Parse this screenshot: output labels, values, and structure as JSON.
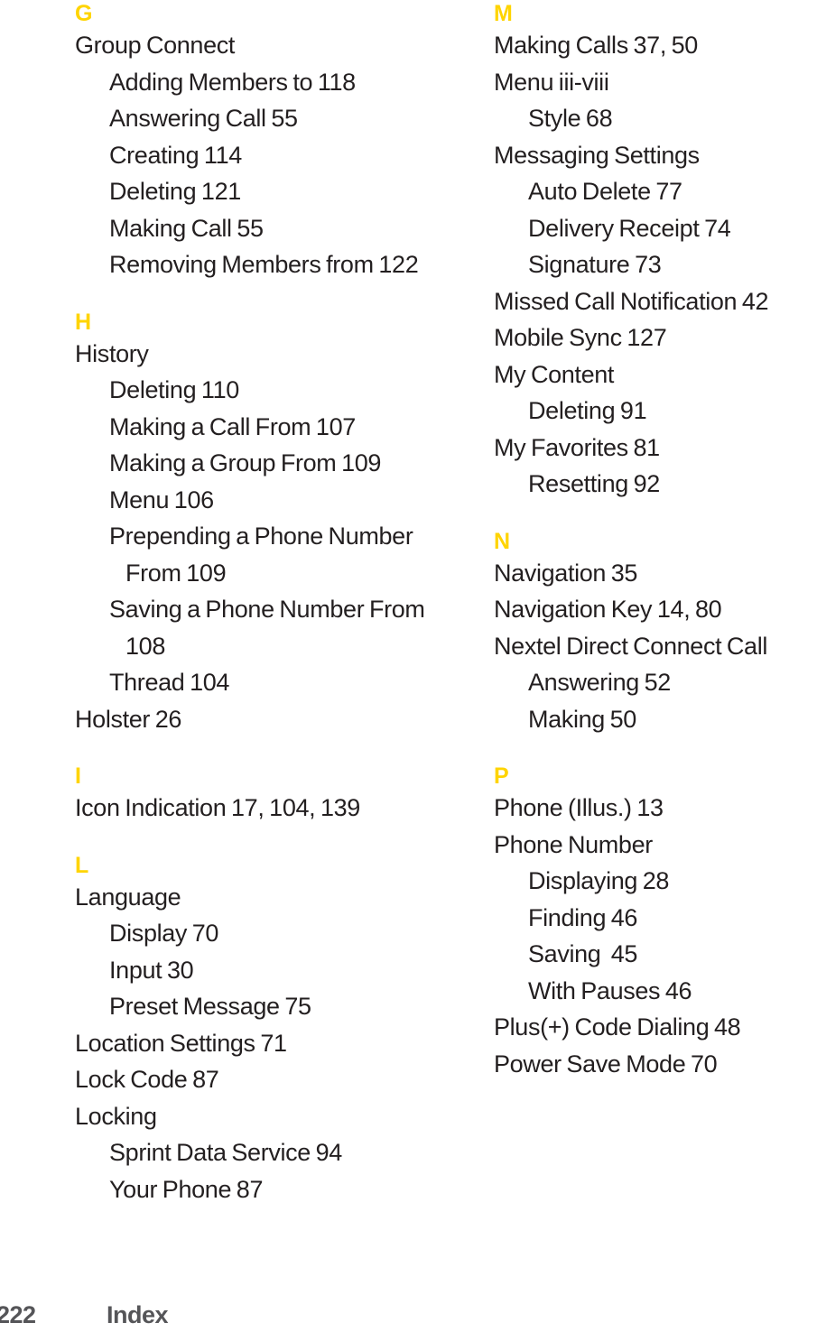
{
  "footer": {
    "page_number": "222",
    "label": "Index"
  },
  "colors": {
    "section_letter": "#FFD400",
    "body_text": "#231F20",
    "footer_text": "#555558"
  },
  "columns": [
    {
      "name": "left",
      "sections": [
        {
          "letter": "G",
          "entries": [
            {
              "level": 1,
              "text": "Group Connect"
            },
            {
              "level": 2,
              "text": "Adding Members to 118"
            },
            {
              "level": 2,
              "text": "Answering Call 55"
            },
            {
              "level": 2,
              "text": "Creating 114"
            },
            {
              "level": 2,
              "text": "Deleting 121"
            },
            {
              "level": 2,
              "text": "Making Call 55"
            },
            {
              "level": 2,
              "wrap": true,
              "text": "Removing Members from 122"
            }
          ]
        },
        {
          "letter": "H",
          "entries": [
            {
              "level": 1,
              "text": "History"
            },
            {
              "level": 2,
              "text": "Deleting 110"
            },
            {
              "level": 2,
              "text": "Making a Call From 107"
            },
            {
              "level": 2,
              "text": "Making a Group From 109"
            },
            {
              "level": 2,
              "text": "Menu 106"
            },
            {
              "level": 2,
              "wrap": true,
              "text": "Prepending a Phone Number From 109"
            },
            {
              "level": 2,
              "wrap": true,
              "text": "Saving a Phone Number From 108"
            },
            {
              "level": 2,
              "text": "Thread 104"
            },
            {
              "level": 1,
              "text": "Holster 26"
            }
          ]
        },
        {
          "letter": "I",
          "entries": [
            {
              "level": 1,
              "text": "Icon Indication 17, 104, 139"
            }
          ]
        },
        {
          "letter": "L",
          "entries": [
            {
              "level": 1,
              "text": "Language"
            },
            {
              "level": 2,
              "text": "Display 70"
            },
            {
              "level": 2,
              "text": "Input 30"
            },
            {
              "level": 2,
              "text": "Preset Message 75"
            },
            {
              "level": 1,
              "text": "Location Settings 71"
            },
            {
              "level": 1,
              "text": "Lock Code 87"
            },
            {
              "level": 1,
              "text": "Locking"
            },
            {
              "level": 2,
              "text": "Sprint Data Service 94"
            },
            {
              "level": 2,
              "text": "Your Phone 87"
            }
          ]
        }
      ]
    },
    {
      "name": "right",
      "sections": [
        {
          "letter": "M",
          "entries": [
            {
              "level": 1,
              "text": "Making Calls 37, 50"
            },
            {
              "level": 1,
              "text": "Menu iii-viii"
            },
            {
              "level": 2,
              "text": "Style 68"
            },
            {
              "level": 1,
              "text": "Messaging Settings"
            },
            {
              "level": 2,
              "text": "Auto Delete 77"
            },
            {
              "level": 2,
              "text": "Delivery Receipt 74"
            },
            {
              "level": 2,
              "text": "Signature 73"
            },
            {
              "level": 1,
              "text": "Missed Call Notification 42"
            },
            {
              "level": 1,
              "text": "Mobile Sync 127"
            },
            {
              "level": 1,
              "text": "My Content"
            },
            {
              "level": 2,
              "text": "Deleting 91"
            },
            {
              "level": 1,
              "text": "My Favorites 81"
            },
            {
              "level": 2,
              "text": "Resetting 92"
            }
          ]
        },
        {
          "letter": "N",
          "entries": [
            {
              "level": 1,
              "text": "Navigation 35"
            },
            {
              "level": 1,
              "text": "Navigation Key 14, 80"
            },
            {
              "level": 1,
              "text": "Nextel Direct Connect Call"
            },
            {
              "level": 2,
              "text": "Answering 52"
            },
            {
              "level": 2,
              "text": "Making 50"
            }
          ]
        },
        {
          "letter": "P",
          "entries": [
            {
              "level": 1,
              "text": "Phone (Illus.) 13"
            },
            {
              "level": 1,
              "text": "Phone Number"
            },
            {
              "level": 2,
              "text": "Displaying 28"
            },
            {
              "level": 2,
              "text": "Finding 46"
            },
            {
              "level": 2,
              "text": "Saving  45"
            },
            {
              "level": 2,
              "text": "With Pauses 46"
            },
            {
              "level": 1,
              "text": "Plus(+) Code Dialing 48"
            },
            {
              "level": 1,
              "text": "Power Save Mode 70"
            }
          ]
        }
      ]
    }
  ]
}
